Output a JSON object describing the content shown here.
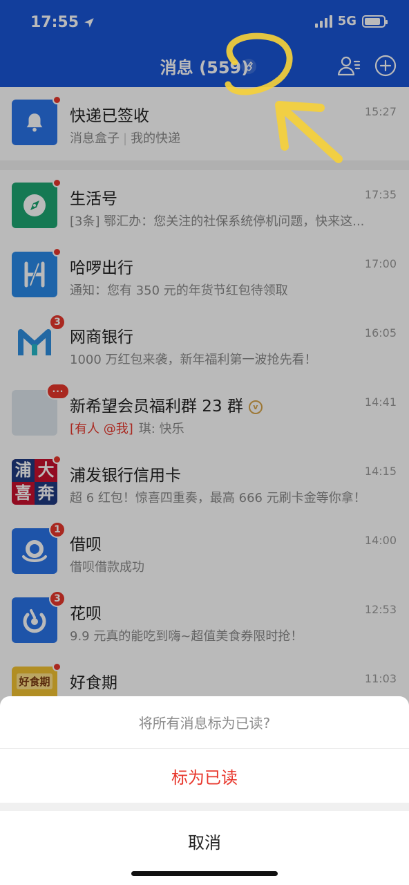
{
  "status": {
    "time": "17:55",
    "network": "5G",
    "battery_level": 0.85
  },
  "nav": {
    "title": "消息 (559)"
  },
  "messages": [
    {
      "title": "快递已签收",
      "source": "消息盒子",
      "source2": "我的快递",
      "time": "15:27",
      "icon": "bell-icon",
      "color": "#2a73e8",
      "unread": "dot"
    },
    {
      "title": "生活号",
      "sub": "[3条] 鄂汇办：您关注的社保系统停机问题，快来这...",
      "time": "17:35",
      "icon": "compass-icon",
      "color": "#1ea672",
      "unread": "dot"
    },
    {
      "title": "哈啰出行",
      "sub": "通知：您有 350 元的年货节红包待领取",
      "time": "17:00",
      "icon": "hello-logo-icon",
      "color": "#2a8ae8",
      "unread": "dot"
    },
    {
      "title": "网商银行",
      "sub": "1000 万红包来袭，新年福利第一波抢先看！",
      "time": "16:05",
      "icon": "mybank-logo-icon",
      "color": "#ffffff",
      "unread": "3"
    },
    {
      "title": "新希望会员福利群 23 群",
      "mention": "[有人 @我]",
      "sub": "琪: 快乐",
      "time": "14:41",
      "icon": "group-avatar-icon",
      "color": "#dfe6ee",
      "unread": "···",
      "verify": "v"
    },
    {
      "title": "浦发银行信用卡",
      "sub": "超 6 红包！惊喜四重奏，最高 666 元刷卡金等你拿！",
      "time": "14:15",
      "icon": "spdb-logo-icon",
      "color": "#c8102e",
      "unread": "dot",
      "logo": {
        "top_left": "浦",
        "top_right": "大",
        "bottom_left": "喜",
        "bottom_right": "奔"
      }
    },
    {
      "title": "借呗",
      "sub": "借呗借款成功",
      "time": "14:00",
      "icon": "jiebei-logo-icon",
      "color": "#2a73e8",
      "unread": "1"
    },
    {
      "title": "花呗",
      "sub": "9.9 元真的能吃到嗨~超值美食券限时抢！",
      "time": "12:53",
      "icon": "huabei-logo-icon",
      "color": "#2a73e8",
      "unread": "3"
    },
    {
      "title": "好食期",
      "sub": "",
      "time": "11:03",
      "icon": "haoshiqi-logo-icon",
      "color": "#f3c332",
      "unread": "dot",
      "logo": {
        "text": "好食期"
      }
    }
  ],
  "sheet": {
    "prompt": "将所有消息标为已读?",
    "confirm": "标为已读",
    "cancel": "取消"
  }
}
